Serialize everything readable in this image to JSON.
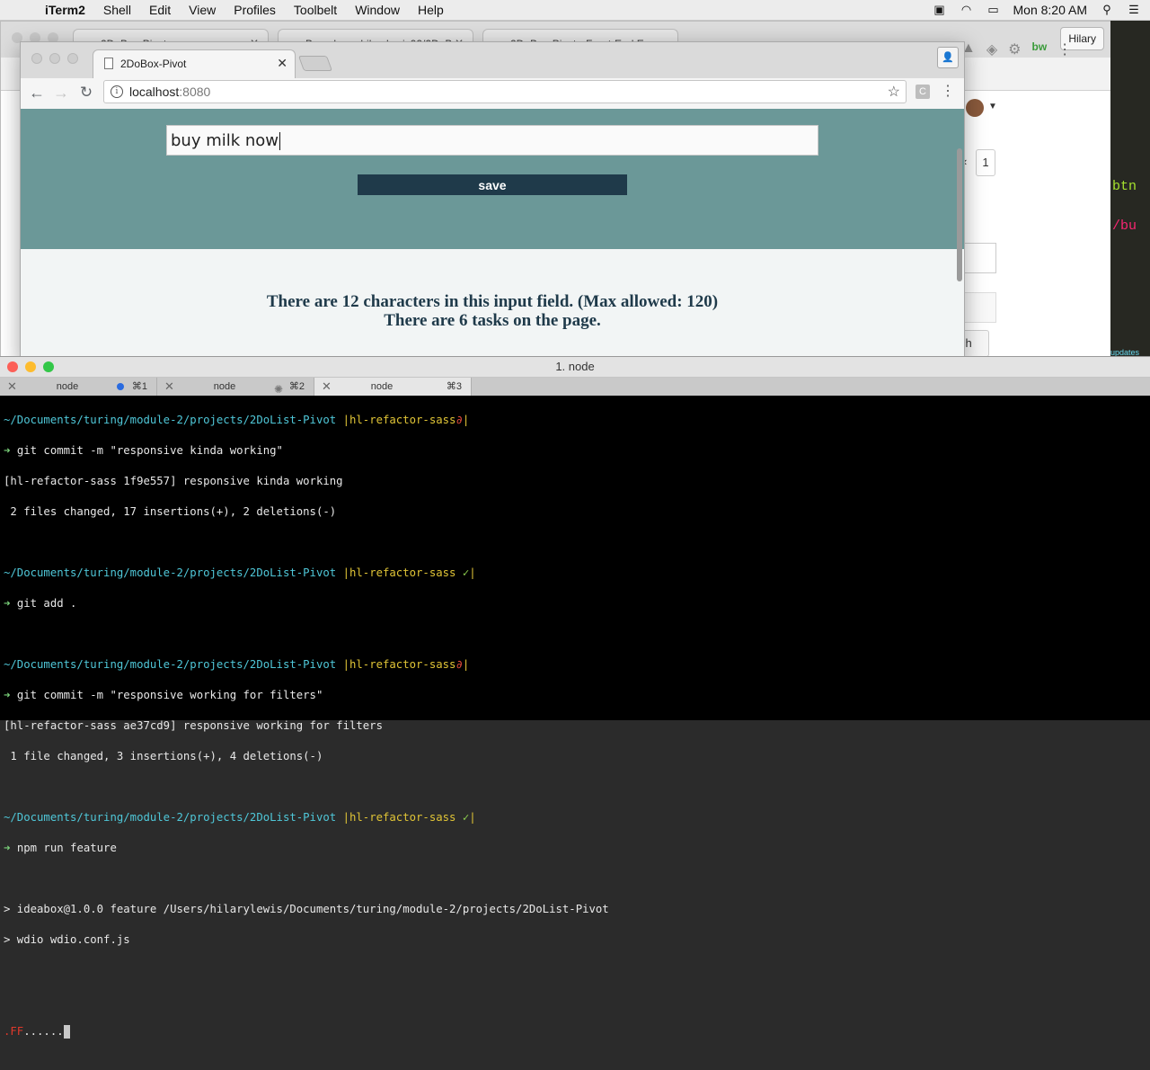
{
  "menubar": {
    "app": "iTerm2",
    "items": [
      "Shell",
      "Edit",
      "View",
      "Profiles",
      "Toolbelt",
      "Window",
      "Help"
    ],
    "clock": "Mon 8:20 AM"
  },
  "back_browser": {
    "tabs": [
      "2DoBox-Pivot",
      "Branches · hilarylewis92/2DoB",
      "2DoBox-Pivot - Front-End Eng"
    ],
    "user_button": "Hilary",
    "pager_current": "1",
    "pager_prev": "‹",
    "button_partial": "ch"
  },
  "editor_strip": {
    "line1": "btn",
    "line2": "/bu",
    "line3": "updates"
  },
  "browser": {
    "tab_title": "2DoBox-Pivot",
    "url_host": "localhost",
    "url_port": ":8080",
    "extension_label": "C"
  },
  "app": {
    "input_value": "buy milk now",
    "save_label": "save",
    "char_count_text": "There are 12 characters in this input field. (Max allowed: 120)",
    "task_count_text": "There are 6 tasks on the page."
  },
  "iterm": {
    "window_title": "1. node",
    "tabs": [
      {
        "name": "node",
        "shortcut": "⌘1"
      },
      {
        "name": "node",
        "shortcut": "⌘2"
      },
      {
        "name": "node",
        "shortcut": "⌘3"
      }
    ]
  },
  "terminal": {
    "prompt_path": "~/Documents/turing/module-2/projects/2DoList-Pivot",
    "branch": "hl-refactor-sass",
    "dirty_mark": "∂",
    "clean_mark": "✓",
    "cmd1": "git commit -m \"responsive kinda working\"",
    "out1a": "[hl-refactor-sass 1f9e557] responsive kinda working",
    "out1b": " 2 files changed, 17 insertions(+), 2 deletions(-)",
    "cmd2": "git add .",
    "cmd3": "git commit -m \"responsive working for filters\"",
    "out3a": "[hl-refactor-sass ae37cd9] responsive working for filters",
    "out3b": " 1 file changed, 3 insertions(+), 4 deletions(-)",
    "cmd4": "npm run feature",
    "out4a": "> ideabox@1.0.0 feature /Users/hilarylewis/Documents/turing/module-2/projects/2DoList-Pivot",
    "out4b": "> wdio wdio.conf.js",
    "progress_fail": ".FF",
    "progress_pass": "......"
  }
}
